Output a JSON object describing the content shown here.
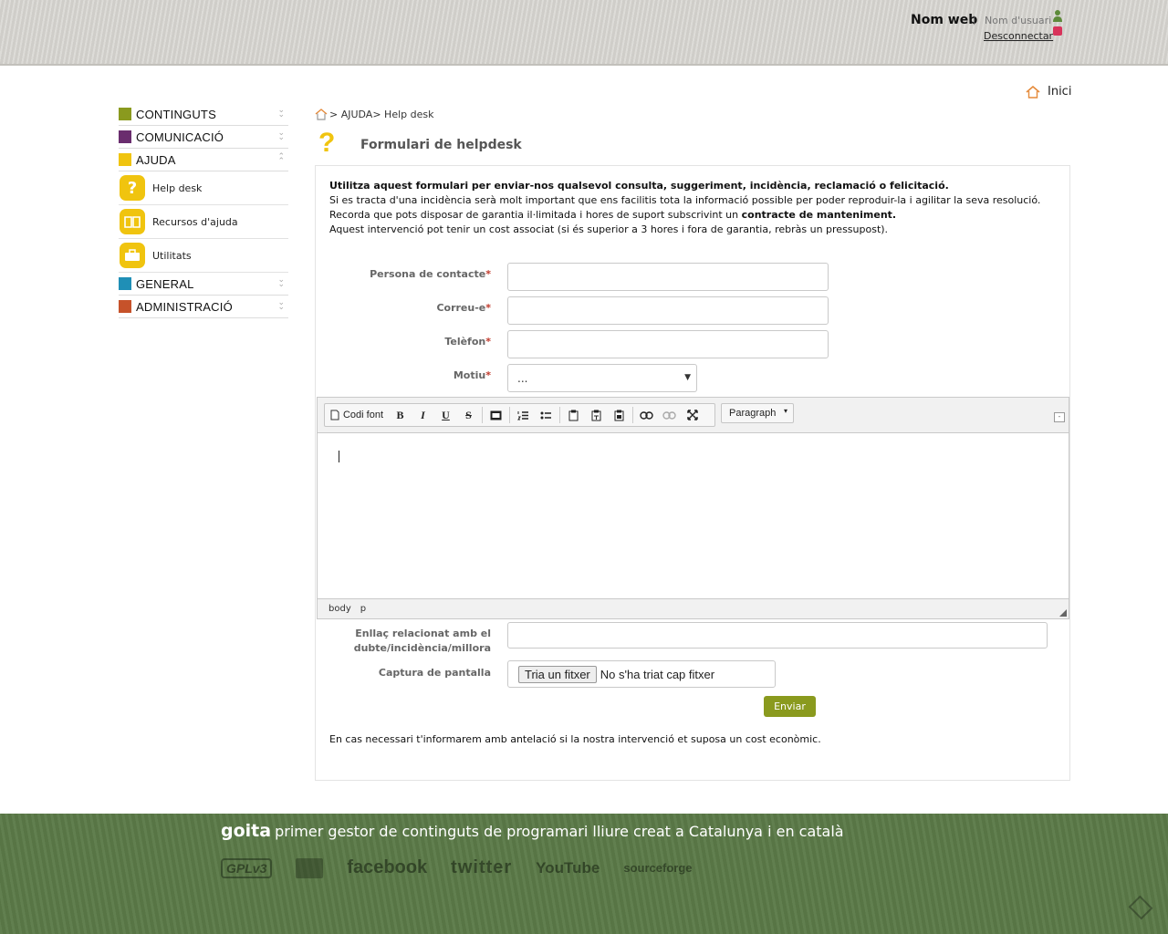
{
  "header": {
    "site_name": "Nom web",
    "separator": "|",
    "user_name": "Nom d'usuari",
    "logout": "Desconnectar"
  },
  "home": {
    "label": "Inici"
  },
  "sidebar": {
    "categories": [
      {
        "label": "CONTINGUTS",
        "color": "#8a9a1e"
      },
      {
        "label": "COMUNICACIÓ",
        "color": "#6a2d6e"
      },
      {
        "label": "AJUDA",
        "color": "#f0c40f"
      },
      {
        "label": "GENERAL",
        "color": "#1f8fb6"
      },
      {
        "label": "ADMINISTRACIÓ",
        "color": "#c6522a"
      }
    ],
    "ajuda_items": [
      {
        "label": "Help desk"
      },
      {
        "label": "Recursos d'ajuda"
      },
      {
        "label": "Utilitats"
      }
    ]
  },
  "breadcrumb": {
    "path": "> AJUDA> Help desk"
  },
  "page": {
    "title": "Formulari de helpdesk"
  },
  "intro": {
    "line1": "Utilitza aquest formulari per enviar-nos qualsevol consulta, suggeriment, incidència, reclamació o felicitació.",
    "line2": "Si es tracta d'una incidència serà molt important que ens facilitis tota la informació possible per poder reproduir-la i agilitar la seva resolució.",
    "line3_a": "Recorda que pots disposar de garantia il·limitada i hores de suport subscrivint un ",
    "line3_b": "contracte de manteniment.",
    "line4": "Aquest intervenció pot tenir un cost associat (si és superior a 3 hores i fora de garantia, rebràs un pressupost)."
  },
  "form": {
    "contact_label": "Persona de contacte",
    "email_label": "Correu-e",
    "phone_label": "Telèfon",
    "reason_label": "Motiu",
    "required_mark": "*",
    "reason_value": "...",
    "link_label_1": "Enllaç relacionat amb el",
    "link_label_2": "dubte/incidència/millora",
    "screenshot_label": "Captura de pantalla",
    "file_button": "Tria un fitxer",
    "file_status": "No s'ha triat cap fitxer",
    "submit": "Enviar",
    "note": "En cas necessari t'informarem amb antelació si la nostra intervenció et suposa un cost econòmic."
  },
  "editor": {
    "source_button": "Codi font",
    "format_select": "Paragraph",
    "status_path": [
      "body",
      "p"
    ]
  },
  "footer": {
    "brand": "goita",
    "tagline": "primer gestor de continguts de programari lliure creat a Catalunya i en català",
    "logos": [
      "GPLv3",
      "facebook",
      "twitter",
      "YouTube",
      "sourceforge"
    ]
  }
}
